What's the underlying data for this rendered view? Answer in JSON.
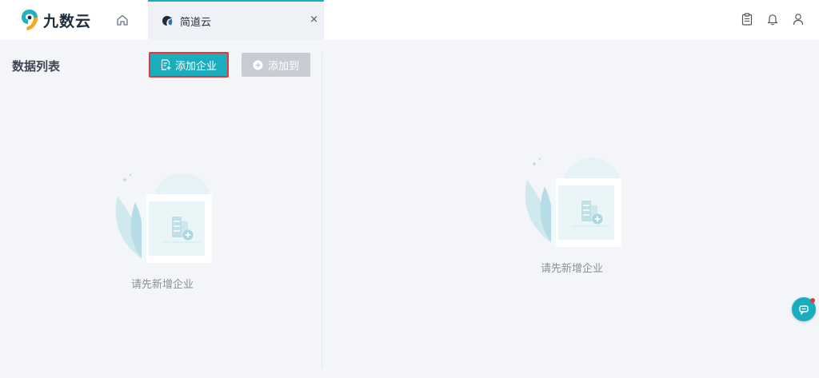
{
  "header": {
    "logo_text": "九数云",
    "tabs": [
      {
        "label": "简道云",
        "icon": "jiandaoyun-logo-icon",
        "active": true
      }
    ],
    "tab_close_glyph": "×",
    "right_icons": [
      "clipboard-icon",
      "bell-icon",
      "user-icon"
    ]
  },
  "left_panel": {
    "title": "数据列表",
    "add_company_label": "添加企业",
    "add_to_label": "添加到",
    "empty_text": "请先新增企业"
  },
  "right_panel": {
    "empty_text": "请先新增企业"
  },
  "floating": {
    "icon": "support-chat-icon",
    "has_notification": true
  },
  "colors": {
    "accent": "#19aebd",
    "highlight_border": "#e23a3a",
    "disabled_button": "#c9ccd3",
    "page_bg": "#f3f5f8"
  }
}
